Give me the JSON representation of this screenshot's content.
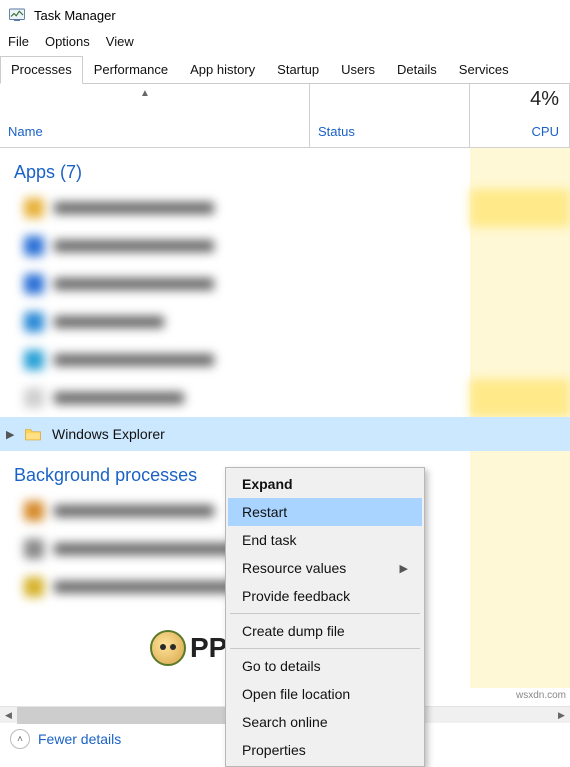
{
  "title": "Task Manager",
  "menus": [
    "File",
    "Options",
    "View"
  ],
  "tabs": [
    "Processes",
    "Performance",
    "App history",
    "Startup",
    "Users",
    "Details",
    "Services"
  ],
  "active_tab": 0,
  "columns": {
    "name": "Name",
    "status": "Status",
    "cpu": "CPU"
  },
  "cpu_total": "4%",
  "groups": {
    "apps": "Apps (7)",
    "background": "Background processes"
  },
  "selected_row": {
    "label": "Windows Explorer"
  },
  "context_menu": {
    "expand": "Expand",
    "restart": "Restart",
    "end_task": "End task",
    "resource_values": "Resource values",
    "provide_feedback": "Provide feedback",
    "create_dump": "Create dump file",
    "go_to_details": "Go to details",
    "open_file_location": "Open file location",
    "search_online": "Search online",
    "properties": "Properties"
  },
  "footer": {
    "fewer": "Fewer details"
  },
  "watermark": "wsxdn.com",
  "logo_text": "PPUALS"
}
